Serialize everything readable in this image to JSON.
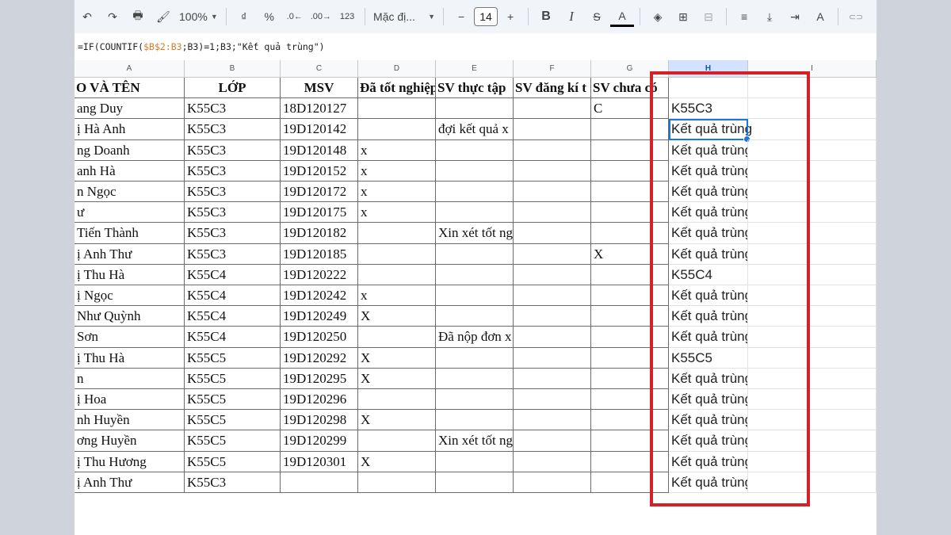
{
  "toolbar": {
    "undo": "↶",
    "redo": "↷",
    "print": "🖶",
    "paint_format": "🖌",
    "zoom": "100%",
    "currency": "₫",
    "percent": "%",
    "dec_decrease": ".0←",
    "dec_increase": ".00→",
    "number_format": "123",
    "font": "Mặc đị...",
    "font_minus": "−",
    "font_size": "14",
    "font_plus": "+",
    "bold": "B",
    "italic": "I",
    "strike": "S",
    "text_color": "A",
    "fill": "◈",
    "borders": "⊞",
    "merge": "⊟",
    "halign": "≡",
    "valign": "⤓",
    "wrap": "⇥",
    "rotate": "A",
    "link": "⊂⊃"
  },
  "formula": {
    "prefix": "=IF(COUNTIF(",
    "ref1": "$B$2:B3",
    "mid": ";B3)=1;B3;\"Kết quả trùng\")"
  },
  "columns": [
    "A",
    "B",
    "C",
    "D",
    "E",
    "F",
    "G",
    "H",
    "I"
  ],
  "header": [
    "O VÀ TÊN",
    "LỚP",
    "MSV",
    "Đã tốt nghiệp",
    "SV thực tập",
    "SV đăng kí t",
    "SV chưa có",
    ""
  ],
  "rows": [
    [
      "ang Duy",
      "K55C3",
      "18D120127",
      "",
      "",
      "",
      "C",
      "K55C3"
    ],
    [
      "ị Hà Anh",
      "K55C3",
      "19D120142",
      "",
      "đợi kết quả x",
      "",
      "",
      "Kết quả trùng"
    ],
    [
      "ng Doanh",
      "K55C3",
      "19D120148",
      "x",
      "",
      "",
      "",
      "Kết quả trùng"
    ],
    [
      "anh Hà",
      "K55C3",
      "19D120152",
      "x",
      "",
      "",
      "",
      "Kết quả trùng"
    ],
    [
      "n Ngọc",
      "K55C3",
      "19D120172",
      "x",
      "",
      "",
      "",
      "Kết quả trùng"
    ],
    [
      "ư",
      "K55C3",
      "19D120175",
      "x",
      "",
      "",
      "",
      "Kết quả trùng"
    ],
    [
      " Tiến Thành",
      "K55C3",
      "19D120182",
      "",
      "Xin xét tốt ng",
      "",
      "",
      "Kết quả trùng"
    ],
    [
      "ị Anh Thư",
      "K55C3",
      "19D120185",
      "",
      "",
      "",
      "X",
      "Kết quả trùng"
    ],
    [
      "ị Thu Hà",
      "K55C4",
      "19D120222",
      "",
      "",
      "",
      "",
      "K55C4"
    ],
    [
      "ị Ngọc",
      "K55C4",
      "19D120242",
      "x",
      "",
      "",
      "",
      "Kết quả trùng"
    ],
    [
      " Như Quỳnh",
      "K55C4",
      "19D120249",
      "X",
      "",
      "",
      "",
      "Kết quả trùng"
    ],
    [
      "Sơn",
      "K55C4",
      "19D120250",
      "",
      "Đã nộp đơn x",
      "",
      "",
      "Kết quả trùng"
    ],
    [
      "ị Thu Hà",
      "K55C5",
      "19D120292",
      "X",
      "",
      "",
      "",
      "K55C5"
    ],
    [
      "n",
      "K55C5",
      "19D120295",
      "X",
      "",
      "",
      "",
      "Kết quả trùng"
    ],
    [
      "ị Hoa",
      "K55C5",
      "19D120296",
      "",
      "",
      "",
      "",
      "Kết quả trùng"
    ],
    [
      "nh Huyền",
      "K55C5",
      "19D120298",
      "X",
      "",
      "",
      "",
      "Kết quả trùng"
    ],
    [
      "ơng Huyền",
      "K55C5",
      "19D120299",
      "",
      "Xin xét tốt ng",
      "",
      "",
      "Kết quả trùng"
    ],
    [
      "ị Thu Hương",
      "K55C5",
      "19D120301",
      "X",
      "",
      "",
      "",
      "Kết quả trùng"
    ],
    [
      "ị Anh Thư",
      "K55C3",
      "",
      "",
      "",
      "",
      "",
      "Kết quả trùng"
    ]
  ]
}
